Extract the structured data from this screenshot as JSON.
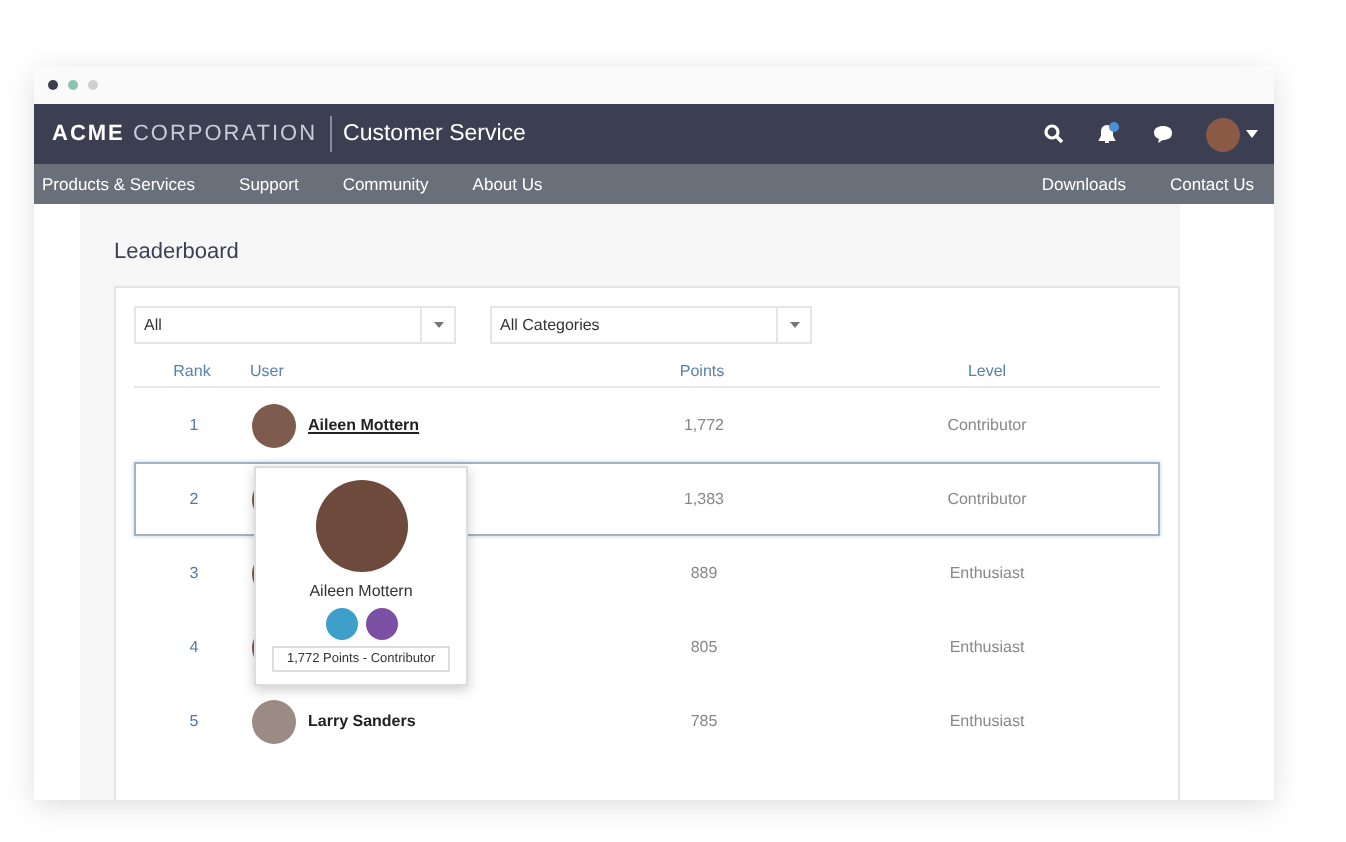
{
  "header": {
    "brand_bold": "ACME",
    "brand_light": "CORPORATION",
    "section": "Customer Service"
  },
  "nav": {
    "left": [
      "Products & Services",
      "Support",
      "Community",
      "About Us"
    ],
    "right": [
      "Downloads",
      "Contact Us"
    ]
  },
  "page": {
    "title": "Leaderboard"
  },
  "filters": [
    {
      "value": "All"
    },
    {
      "value": "All Categories"
    }
  ],
  "table": {
    "columns": [
      "Rank",
      "User",
      "Points",
      "Level"
    ],
    "rows": [
      {
        "rank": "1",
        "user": "Aileen Mottern",
        "points": "1,772",
        "level": "Contributor",
        "selected": false
      },
      {
        "rank": "2",
        "points": "1,383",
        "level": "Contributor",
        "selected": true
      },
      {
        "rank": "3",
        "points": "889",
        "level": "Enthusiast",
        "selected": false
      },
      {
        "rank": "4",
        "points": "805",
        "level": "Enthusiast",
        "selected": false
      },
      {
        "rank": "5",
        "user": "Larry Sanders",
        "points": "785",
        "level": "Enthusiast",
        "selected": false
      }
    ]
  },
  "popover": {
    "name": "Aileen Mottern",
    "badges": [
      {
        "color": "#3e9fc9"
      },
      {
        "color": "#7b4fa3"
      }
    ],
    "summary": "1,772 Points - Contributor"
  }
}
